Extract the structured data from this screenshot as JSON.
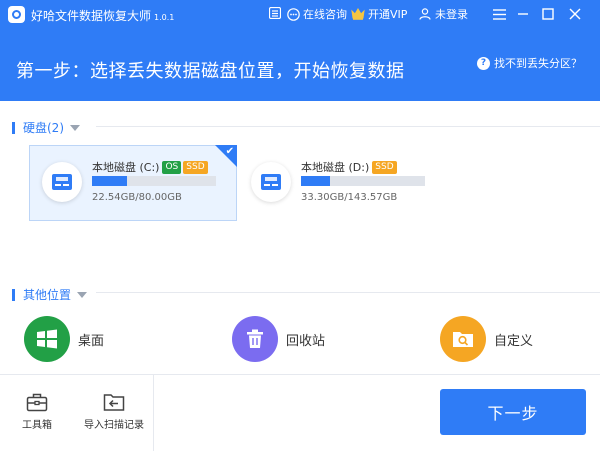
{
  "titlebar": {
    "app_title": "好哈文件数据恢复大师",
    "version": "1.0.1",
    "online_consult": "在线咨询",
    "open_vip": "开通VIP",
    "login": "未登录"
  },
  "header": {
    "step_title": "第一步：选择丢失数据磁盘位置，开始恢复数据",
    "help_link": "找不到丢失分区？"
  },
  "disks_section": {
    "title": "硬盘(2)",
    "disks": [
      {
        "name": "本地磁盘 (C:)",
        "tags": [
          "OS",
          "SSD"
        ],
        "size": "22.54GB/80.00GB",
        "used_fraction": 0.2818,
        "selected": true
      },
      {
        "name": "本地磁盘 (D:)",
        "tags": [
          "SSD"
        ],
        "size": "33.30GB/143.57GB",
        "used_fraction": 0.2319,
        "selected": false
      }
    ]
  },
  "other_section": {
    "title": "其他位置",
    "locations": [
      {
        "label": "桌面",
        "icon": "windows-icon",
        "color": "#22a046"
      },
      {
        "label": "回收站",
        "icon": "trash-icon",
        "color": "#7b6cf0"
      },
      {
        "label": "自定义",
        "icon": "folder-search-icon",
        "color": "#f5a623"
      }
    ]
  },
  "bottom": {
    "toolbox": "工具箱",
    "import_scan": "导入扫描记录",
    "next_button": "下一步"
  },
  "colors": {
    "accent": "#2f7cf6",
    "os_tag": "#22a046",
    "ssd_tag": "#f5a623"
  }
}
